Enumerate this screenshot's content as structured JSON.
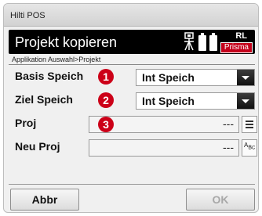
{
  "window": {
    "title": "Hilti POS"
  },
  "header": {
    "title": "Projekt kopieren",
    "status_label": "RL",
    "mode_badge": "Prisma",
    "icons": [
      "tripod-icon",
      "battery-icon",
      "battery-icon"
    ]
  },
  "breadcrumb": "Applikation Auswahl>Projekt",
  "form": {
    "basis": {
      "label": "Basis Speich",
      "step": "1",
      "value": "Int Speich"
    },
    "ziel": {
      "label": "Ziel Speich",
      "step": "2",
      "value": "Int Speich"
    },
    "proj": {
      "label": "Proj",
      "step": "3",
      "value": "---"
    },
    "neu": {
      "label": "Neu Proj",
      "value": "---"
    }
  },
  "buttons": {
    "cancel": "Abbr",
    "ok": "OK"
  },
  "colors": {
    "badge": "#cc0018",
    "header_bg": "#000000",
    "prisma": "#c4001b"
  }
}
